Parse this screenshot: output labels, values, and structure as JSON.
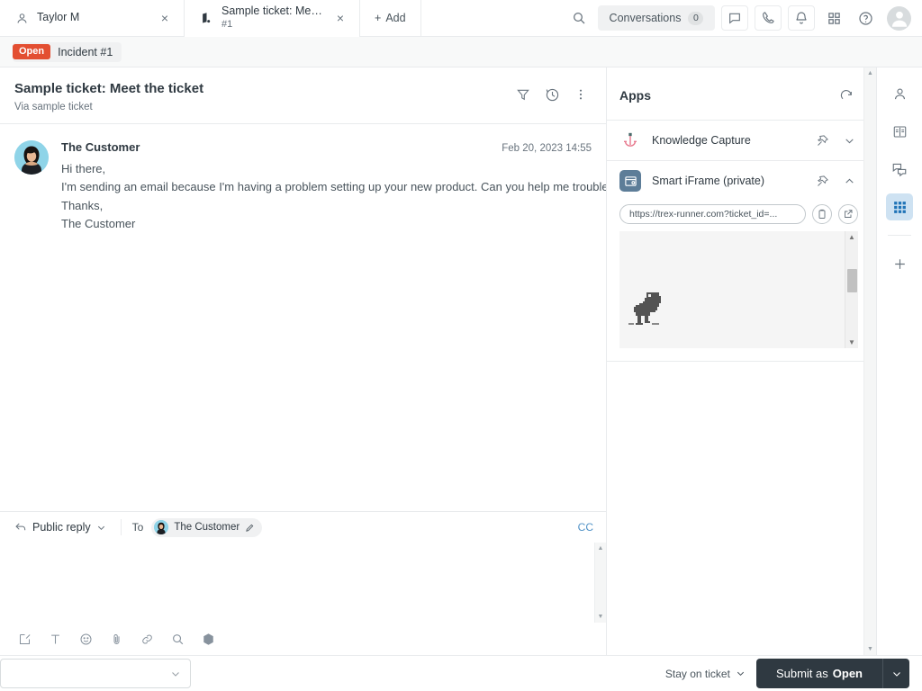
{
  "tabs": [
    {
      "icon": "user-icon",
      "title": "Taylor M",
      "sub": "",
      "close": "×"
    },
    {
      "icon": "ticket-icon",
      "title": "Sample ticket: Meet the ...",
      "sub": "#1",
      "close": "×"
    }
  ],
  "add_tab_label": "Add",
  "add_tab_plus": "+",
  "topbar": {
    "search_icon": "search-icon",
    "conversations_label": "Conversations",
    "conversations_count": "0",
    "chat_icon": "chat-bubble-icon",
    "call_icon": "phone-icon",
    "bell_icon": "bell-icon",
    "grid_icon": "apps-grid-icon",
    "help_icon": "help-circle-icon",
    "avatar": "user-avatar-icon"
  },
  "status": {
    "badge": "Open",
    "label": "Incident #1"
  },
  "ticket": {
    "title": "Sample ticket: Meet the ticket",
    "subtitle": "Via sample ticket",
    "actions": [
      "filter-icon",
      "history-icon",
      "more-icon"
    ]
  },
  "message": {
    "author": "The Customer",
    "timestamp": "Feb 20, 2023 14:55",
    "lines": [
      "Hi there,",
      "I'm sending an email because I'm having a problem setting up your new product. Can you help me troubleshoot?",
      "Thanks,",
      "The Customer"
    ]
  },
  "composer": {
    "reply_type": "Public reply",
    "to_label": "To",
    "recipient": "The Customer",
    "cc_label": "CC",
    "placeholder": "",
    "value": "",
    "tools": [
      "rich-text-icon",
      "text-format-icon",
      "emoji-icon",
      "attachment-icon",
      "link-icon",
      "search-icon",
      "app-cube-icon"
    ]
  },
  "apps": {
    "title": "Apps",
    "refresh_icon": "refresh-icon",
    "items": [
      {
        "name": "Knowledge Capture",
        "icon": "anchor-icon",
        "pin_icon": "pin-icon",
        "chevron": "chevron-down-icon",
        "expanded": false
      },
      {
        "name": "Smart iFrame (private)",
        "icon": "browser-window-icon",
        "pin_icon": "pin-icon",
        "chevron": "chevron-up-icon",
        "expanded": true,
        "url": "https://trex-runner.com?ticket_id=...",
        "copy_icon": "clipboard-icon",
        "open_icon": "external-link-icon",
        "content": "trex-runner-dino"
      }
    ]
  },
  "rail": {
    "items": [
      {
        "icon": "user-icon",
        "name": "customer-context",
        "active": false
      },
      {
        "icon": "knowledge-book-icon",
        "name": "knowledge",
        "active": false
      },
      {
        "icon": "conversations-icon",
        "name": "conversations",
        "active": false
      },
      {
        "icon": "apps-grid-icon",
        "name": "apps",
        "active": true
      }
    ],
    "add_icon": "plus-icon"
  },
  "bottom": {
    "macro_placeholder": "",
    "macro_chevron": "chevron-down-icon",
    "stay_on_ticket": "Stay on ticket",
    "submit_prefix": "Submit as ",
    "submit_status": "Open",
    "submit_chevron": "chevron-down-icon"
  },
  "colors": {
    "status_open": "#e34f32",
    "submit_dark": "#2f3941",
    "link_blue": "#5293c7",
    "rail_active_bg": "#cee2f2",
    "rail_active_fg": "#1f73b7",
    "app_icon_bg": "#5d7d98",
    "anchor_pink": "#e8798e",
    "border": "#e9ebed"
  }
}
